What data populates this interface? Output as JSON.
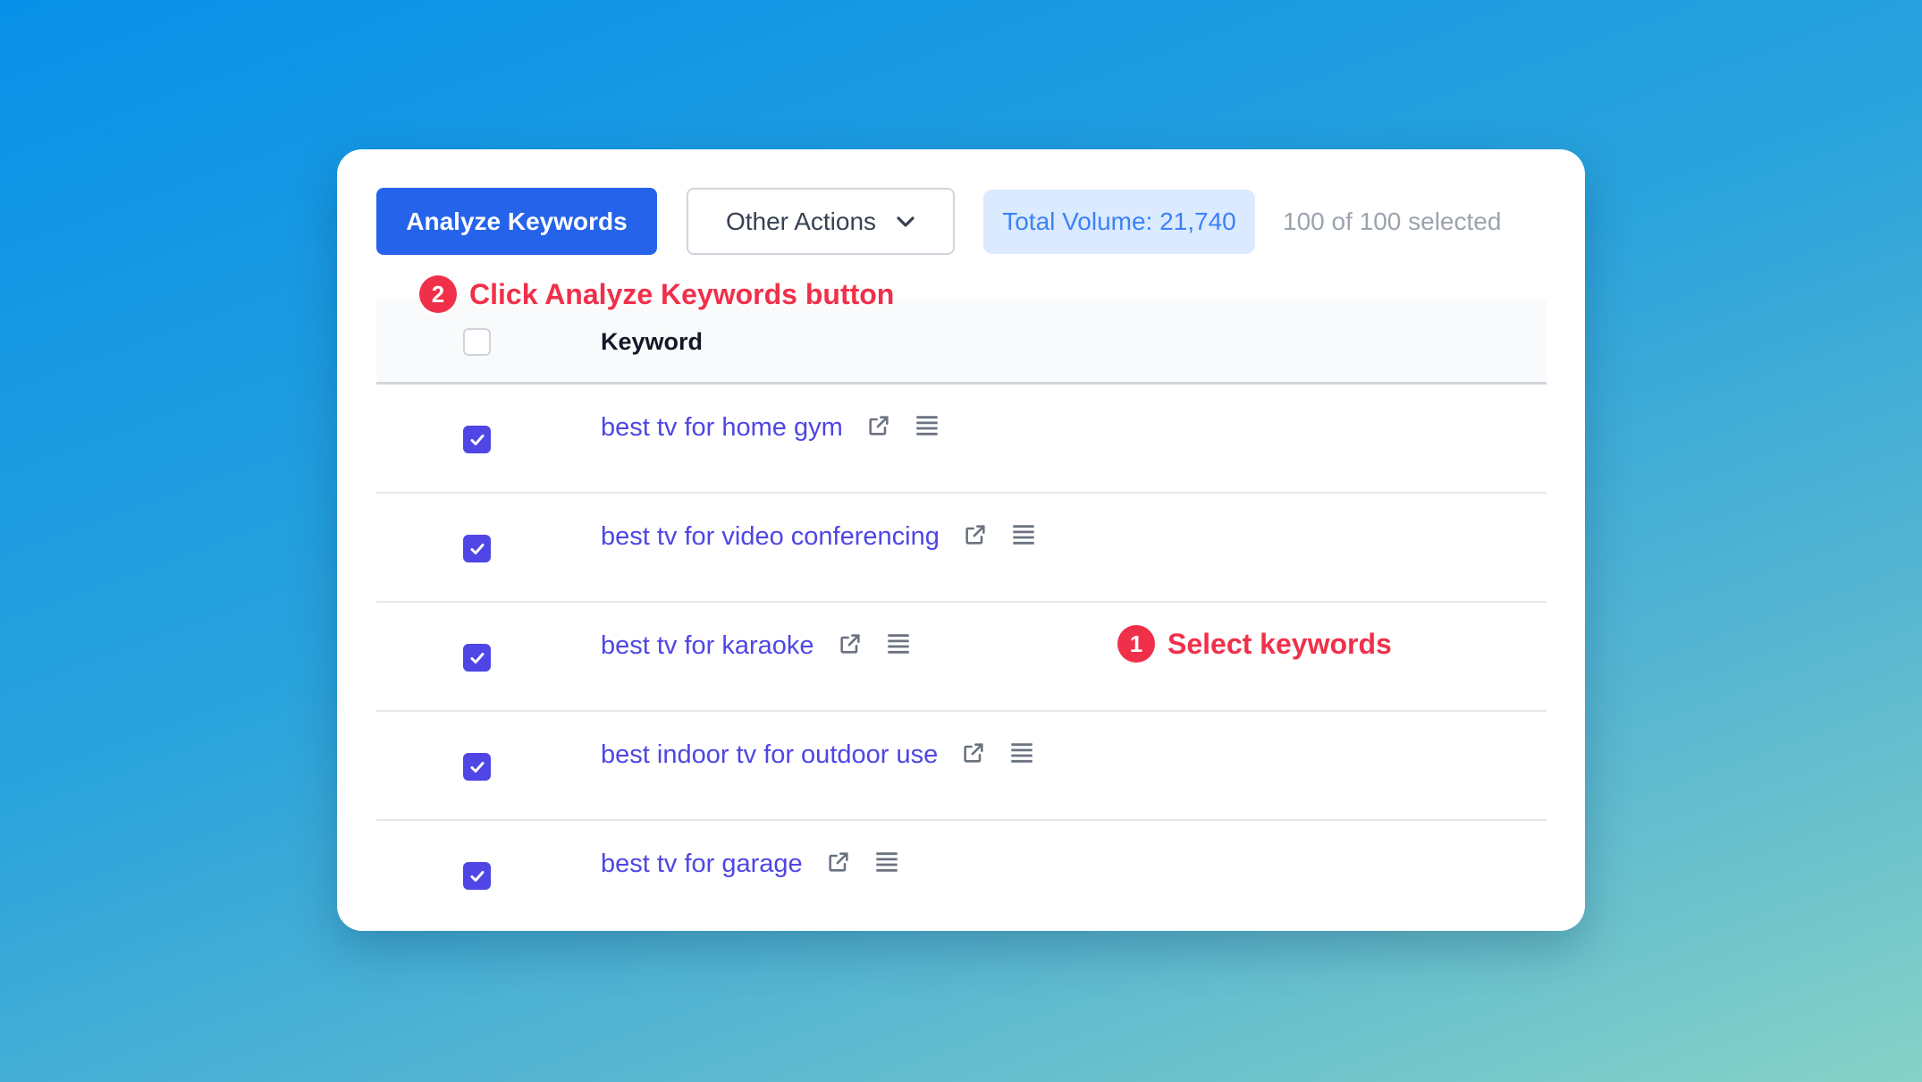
{
  "toolbar": {
    "analyze_label": "Analyze Keywords",
    "other_actions_label": "Other Actions",
    "total_volume": "Total Volume: 21,740",
    "selection_count": "100 of 100 selected"
  },
  "table": {
    "header_keyword": "Keyword",
    "header_checked": false,
    "rows": [
      {
        "keyword": "best tv for home gym",
        "checked": true
      },
      {
        "keyword": "best tv for video conferencing",
        "checked": true
      },
      {
        "keyword": "best tv for karaoke",
        "checked": true
      },
      {
        "keyword": "best indoor tv for outdoor use",
        "checked": true
      },
      {
        "keyword": "best tv for garage",
        "checked": true
      }
    ]
  },
  "annotations": [
    {
      "number": "1",
      "text": "Select keywords"
    },
    {
      "number": "2",
      "text": "Click Analyze Keywords button"
    }
  ],
  "colors": {
    "primary": "#2563eb",
    "checkbox": "#4f46e5",
    "annotation": "#f0304a"
  },
  "icons": [
    "external-link-icon",
    "list-icon",
    "chevron-down-icon",
    "check-icon"
  ]
}
